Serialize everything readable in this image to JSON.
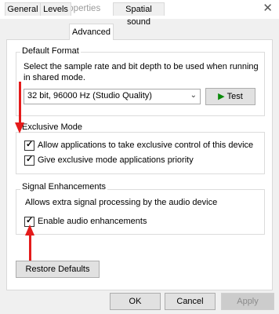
{
  "window": {
    "title": "Speakers Properties",
    "close_glyph": "✕"
  },
  "tabs": [
    {
      "label": "General"
    },
    {
      "label": "Levels"
    },
    {
      "label": "Advanced"
    },
    {
      "label": "Spatial sound"
    }
  ],
  "default_format": {
    "legend": "Default Format",
    "description": "Select the sample rate and bit depth to be used when running in shared mode.",
    "selected_format": "32 bit, 96000 Hz (Studio Quality)",
    "test_label": "Test"
  },
  "exclusive_mode": {
    "legend": "Exclusive Mode",
    "options": [
      {
        "label": "Allow applications to take exclusive control of this device",
        "checked": true
      },
      {
        "label": "Give exclusive mode applications priority",
        "checked": true
      }
    ]
  },
  "signal_enhancements": {
    "legend": "Signal Enhancements",
    "description": "Allows extra signal processing by the audio device",
    "option": {
      "label": "Enable audio enhancements",
      "checked": true
    }
  },
  "restore_defaults_label": "Restore Defaults",
  "footer": {
    "ok": "OK",
    "cancel": "Cancel",
    "apply": "Apply"
  },
  "colors": {
    "annotation_arrow": "#e41b1b",
    "test_icon": "#0a8a0a",
    "window_bg": "#f0f0f0"
  },
  "icons": {
    "title": "speaker-icon",
    "test": "play-icon"
  }
}
